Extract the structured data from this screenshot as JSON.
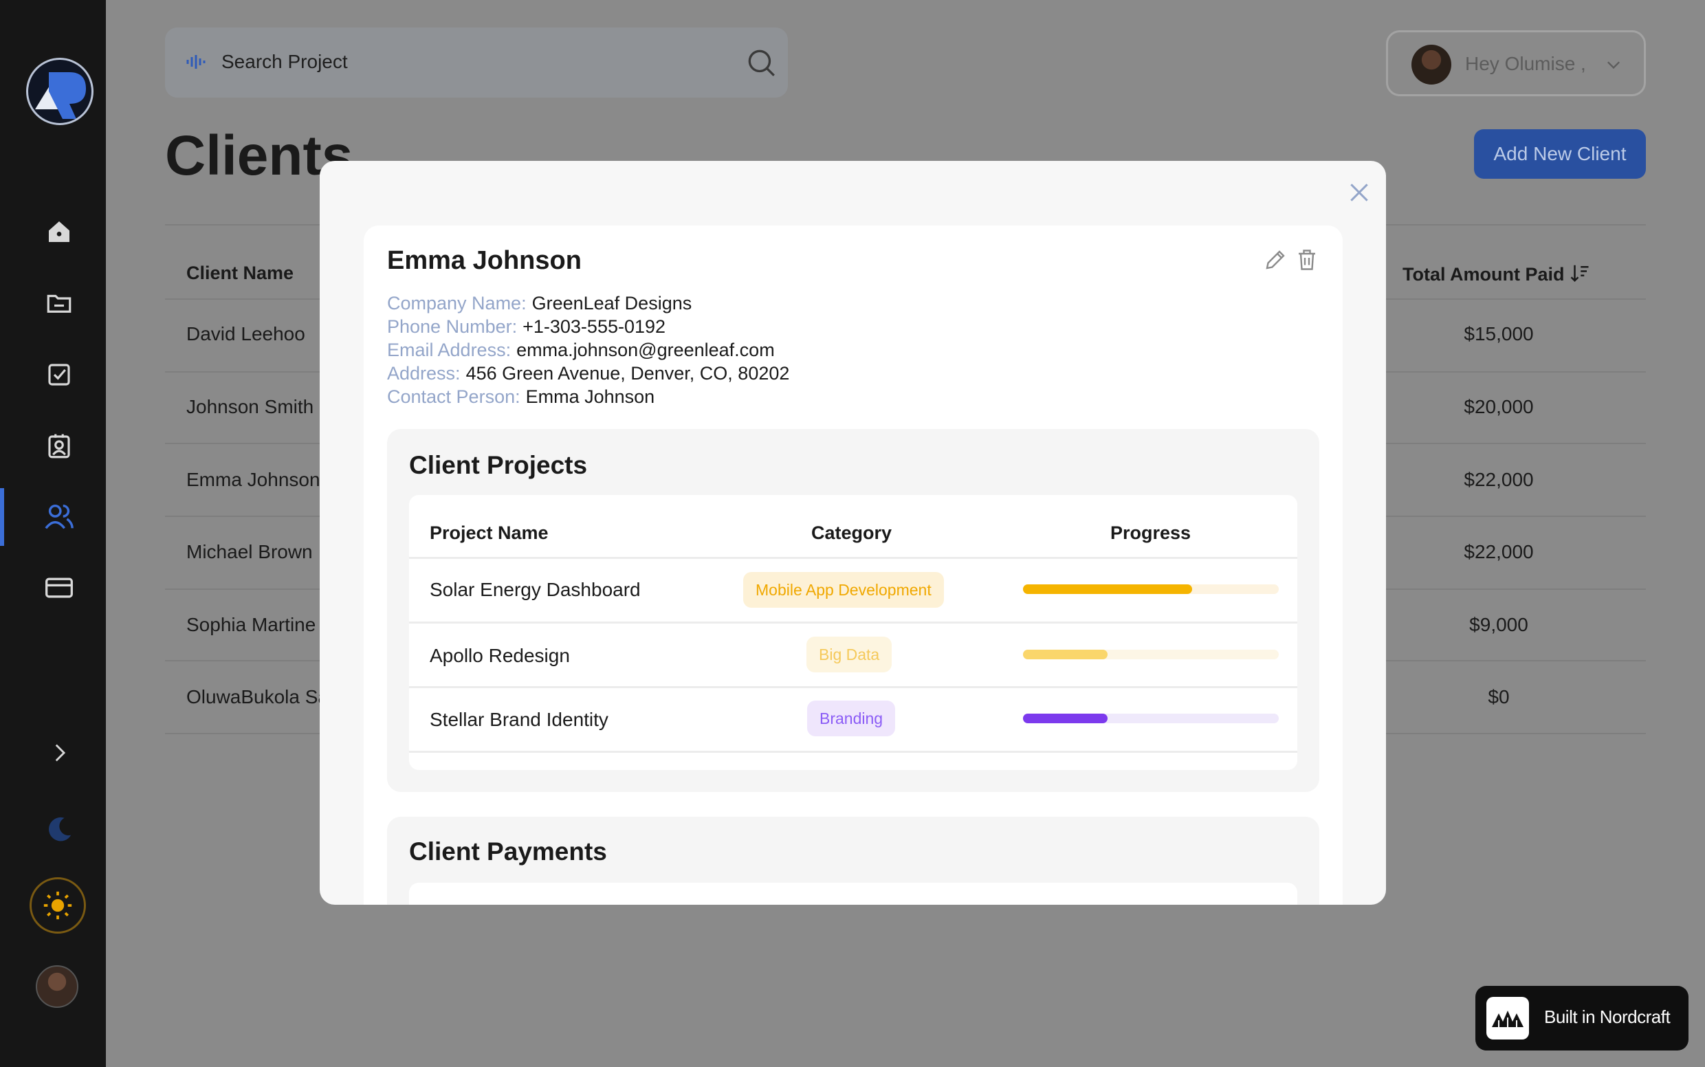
{
  "search": {
    "placeholder": "Search Project"
  },
  "user": {
    "greeting": "Hey Olumise ,"
  },
  "page": {
    "title": "Clients",
    "add_button": "Add New Client"
  },
  "table": {
    "col_client_name": "Client Name",
    "col_total_paid": "Total Amount Paid",
    "rows": [
      {
        "name": "David Leehoo",
        "amount": "$15,000"
      },
      {
        "name": "Johnson Smith",
        "amount": "$20,000"
      },
      {
        "name": "Emma Johnson",
        "amount": "$22,000"
      },
      {
        "name": "Michael Brown",
        "amount": "$22,000"
      },
      {
        "name": "Sophia Martine",
        "amount": "$9,000"
      },
      {
        "name": "OluwaBukola Sa",
        "amount": "$0"
      }
    ]
  },
  "modal": {
    "client_name": "Emma Johnson",
    "info": [
      {
        "label": "Company Name:",
        "value": "GreenLeaf Designs"
      },
      {
        "label": "Phone Number:",
        "value": "+1-303-555-0192"
      },
      {
        "label": "Email Address:",
        "value": "emma.johnson@greenleaf.com"
      },
      {
        "label": "Address:",
        "value": "456 Green Avenue, Denver, CO, 80202"
      },
      {
        "label": "Contact Person:",
        "value": "Emma Johnson"
      }
    ],
    "projects": {
      "title": "Client Projects",
      "headers": {
        "name": "Project Name",
        "category": "Category",
        "progress": "Progress"
      },
      "rows": [
        {
          "name": "Solar Energy Dashboard",
          "category": "Mobile App Development",
          "progress": 0.66,
          "color": "#f5b400",
          "track": "#fdf3e0",
          "badge_bg": "#fdf1d6",
          "badge_fg": "#f0a800"
        },
        {
          "name": "Apollo Redesign",
          "category": "Big Data",
          "progress": 0.33,
          "color": "#fad66b",
          "track": "#fdf6e6",
          "badge_bg": "#fdf5e0",
          "badge_fg": "#f5c95a"
        },
        {
          "name": "Stellar Brand Identity",
          "category": "Branding",
          "progress": 0.33,
          "color": "#7c3aed",
          "track": "#efe9fb",
          "badge_bg": "#efe6fc",
          "badge_fg": "#8b5cf6"
        }
      ]
    },
    "payments": {
      "title": "Client Payments"
    }
  },
  "footer": {
    "built_in": "Built in Nordcraft"
  },
  "colors": {
    "accent": "#2950a0",
    "sidebar": "#161616",
    "overlay": "#8a8a8a"
  }
}
